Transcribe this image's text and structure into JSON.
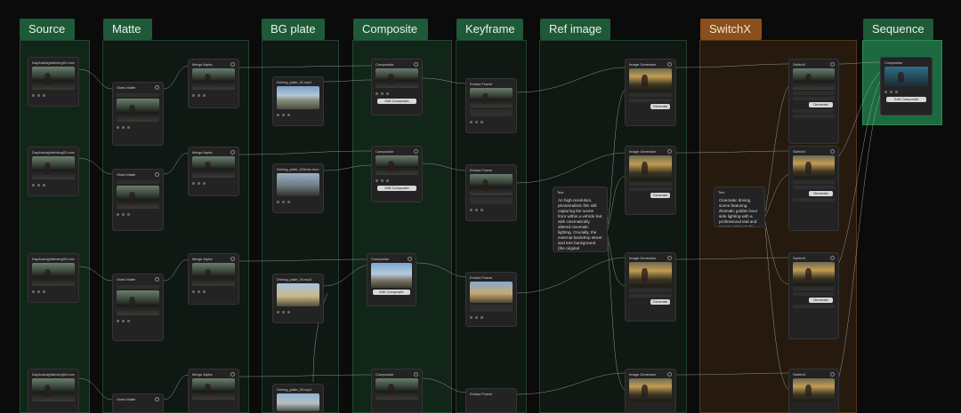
{
  "lanes": [
    {
      "key": "source",
      "label": "Source"
    },
    {
      "key": "matte",
      "label": "Matte"
    },
    {
      "key": "bgplate",
      "label": "BG plate"
    },
    {
      "key": "composite",
      "label": "Composite"
    },
    {
      "key": "keyframe",
      "label": "Keyframe"
    },
    {
      "key": "refimage",
      "label": "Ref image"
    },
    {
      "key": "switchx",
      "label": "SwitchX"
    },
    {
      "key": "sequence",
      "label": "Sequence"
    }
  ],
  "source_nodes": [
    "DayAndnightdriving01.mov",
    "DayAndnightdriving02.mov",
    "DayAndnightdriving03.mov",
    "DayAndnightdriving04.mov"
  ],
  "matte_title": "Video Matte",
  "merge_title": "Merge Alpha",
  "bg_plates": [
    "Driving_plate_01.mp4",
    "Driving_plate_02drive.mov",
    "Driving_plate_04.mp4",
    "Driving_plate_03.mp4"
  ],
  "composite_title": "Compositor",
  "composite_button": "Edit Composite",
  "keyframe_title": "Extract Frame",
  "image_gen_title": "Image Generator",
  "generate_label": "Generate",
  "switch_title": "SwitchX",
  "text_title": "Text",
  "prompt_left": "An high-resolution, photorealistic film still capturing the scene from within a vehicle but with cinematically altered cinematic lighting. Crucially, the external backdrop street and tree background (the original",
  "prompt_right": "Cinematic driving scene featuring dramatic golden hour side lighting with a professional teal and orange color grade. Deep, rich black shadows combined",
  "sequence_title": "Compositor",
  "sequence_button": "Edit Composite",
  "colors": {
    "lane_green": "#1f5a38",
    "lane_orange": "#8a4f1c",
    "sequence_active": "#1e6a40",
    "wire": "#c9c9c9"
  }
}
